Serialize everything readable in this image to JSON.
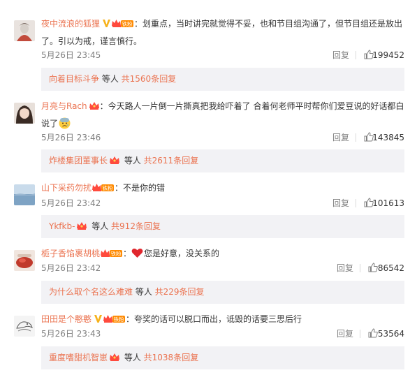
{
  "comments": [
    {
      "user": "夜中流浪的狐狸",
      "verified": true,
      "fan_badge": "铁粉",
      "separator": "：",
      "text": "划重点，当时讲完就觉得不妥，也和节目组沟通了，但节目组还是放出了。引以为戒，谨言慎行。",
      "time": "5月26日 23:45",
      "reply_label": "回复",
      "likes": "199452",
      "sub": {
        "user": "向着目标斗争",
        "mid": " 等人 ",
        "count": "共1560条回复",
        "crown": false
      }
    },
    {
      "user": "月亮与Rach",
      "verified": false,
      "fan_badge": "",
      "separator": "：",
      "text": "今天路人一片倒一片撕真把我给吓着了 合着何老师平时帮你们爱豆说的好话都白说了",
      "emoji": "😰",
      "time": "5月26日 23:46",
      "reply_label": "回复",
      "likes": "143845",
      "sub": {
        "user": "炸楼集团董事长",
        "mid": " 等人 ",
        "count": "共2611条回复",
        "crown": true
      }
    },
    {
      "user": "山下采药勿扰",
      "verified": false,
      "fan_badge": "铁粉",
      "separator": "：",
      "text": "不是你的错",
      "time": "5月26日 23:42",
      "reply_label": "回复",
      "likes": "101613",
      "sub": {
        "user": "Ykfkb-",
        "mid": " 等人 ",
        "count": "共912条回复",
        "crown": true
      }
    },
    {
      "user": "栀子香馅裹胡桃",
      "verified": false,
      "fan_badge": "铁粉",
      "separator": "：",
      "text": "您是好意，没关系的",
      "heart": true,
      "time": "5月26日 23:42",
      "reply_label": "回复",
      "likes": "86542",
      "sub": {
        "user": "为什么取个名这么难难",
        "mid": " 等人 ",
        "count": "共229条回复",
        "crown": false
      }
    },
    {
      "user": "田田是个憨憨",
      "verified": true,
      "fan_badge": "铁粉",
      "separator": "：",
      "text": "夸奖的话可以脱口而出，诋毁的话要三思后行",
      "time": "5月26日 23:43",
      "reply_label": "回复",
      "likes": "53564",
      "sub": {
        "user": "重度嗜甜机智崽",
        "mid": " 等人 ",
        "count": "共1038条回复",
        "crown": true
      }
    }
  ],
  "colors": {
    "username": "#eb7350",
    "meta": "#808080",
    "sub_bg": "#f2f2f5",
    "verified": "#f6b21c",
    "fan_badge": "#ff8a00"
  },
  "icons": {
    "verified": "verified-v-icon",
    "fan": "fan-crown-badge-icon",
    "like": "thumbs-up-icon",
    "heart": "heart-emoji-icon",
    "sad": "anxious-face-emoji-icon"
  }
}
